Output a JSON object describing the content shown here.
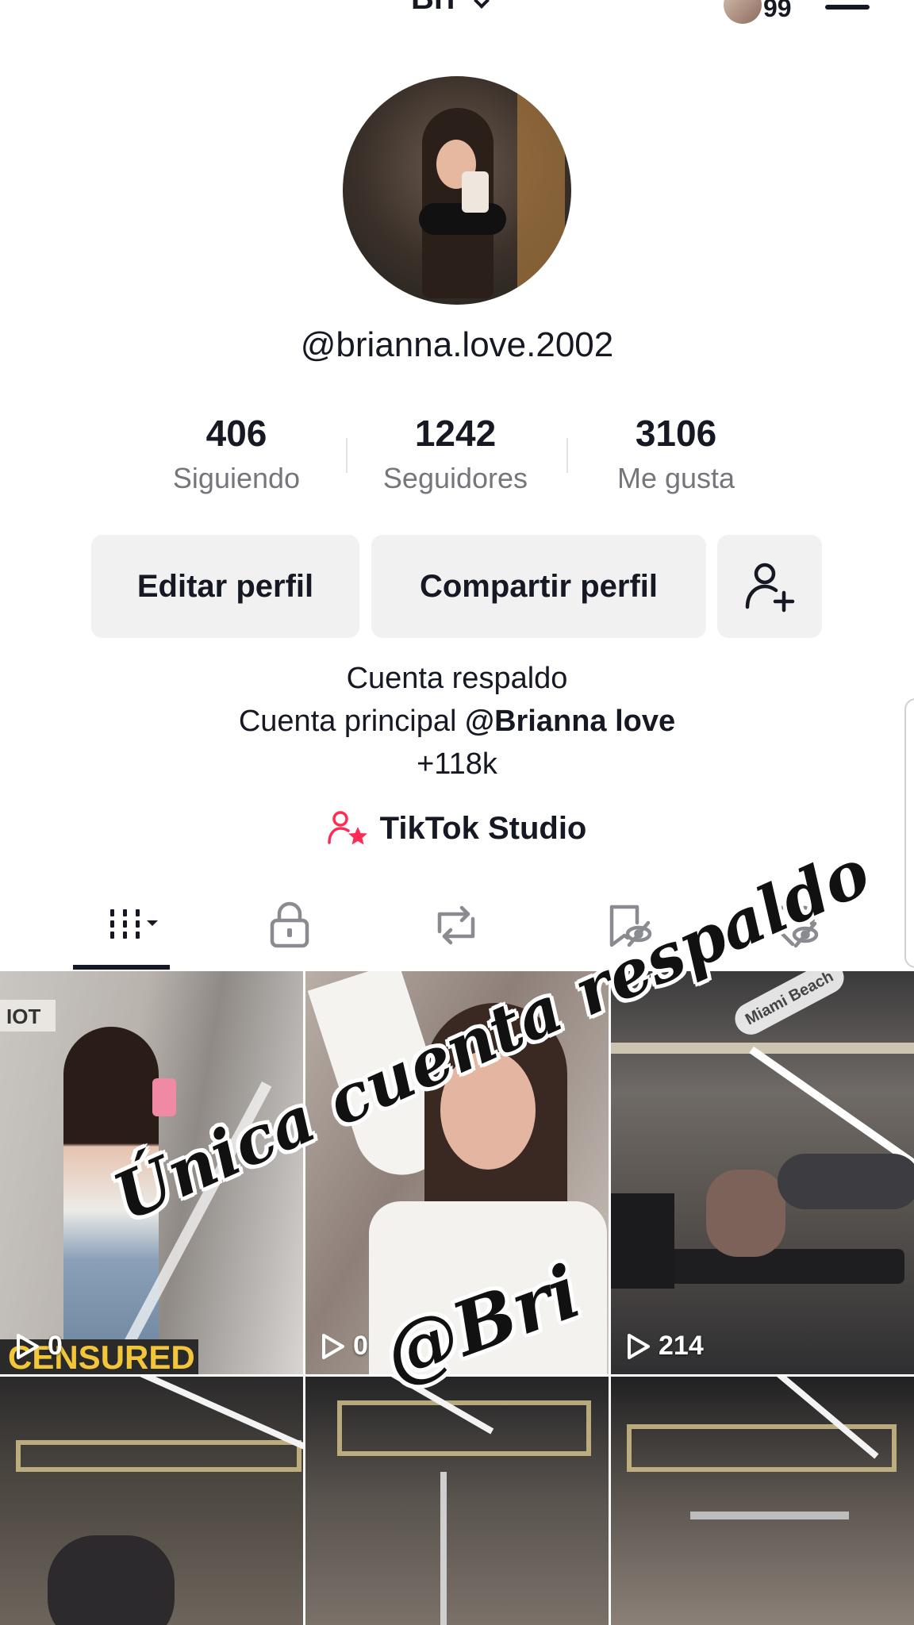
{
  "header": {
    "title": "Bri",
    "notification_count": "99"
  },
  "profile": {
    "username": "@brianna.love.2002"
  },
  "stats": [
    {
      "value": "406",
      "label": "Siguiendo"
    },
    {
      "value": "1242",
      "label": "Seguidores"
    },
    {
      "value": "3106",
      "label": "Me gusta"
    }
  ],
  "actions": {
    "edit_label": "Editar perfil",
    "share_label": "Compartir perfil"
  },
  "bio": {
    "line1": "Cuenta respaldo",
    "line2_prefix": "Cuenta principal ",
    "line2_mention": "@Brianna love",
    "line3": "+118k"
  },
  "studio": {
    "label": "TikTok Studio"
  },
  "tabs": [
    {
      "icon": "grid-icon",
      "active": true
    },
    {
      "icon": "lock-icon",
      "active": false
    },
    {
      "icon": "repost-icon",
      "active": false
    },
    {
      "icon": "bookmark-hidden-icon",
      "active": false
    },
    {
      "icon": "liked-hidden-icon",
      "active": false
    }
  ],
  "videos": [
    {
      "views": "0",
      "sticker": "IOT",
      "banner": "CENSURED"
    },
    {
      "views": "0"
    },
    {
      "views": "214",
      "location": "Miami Beach"
    },
    {
      "views": ""
    },
    {
      "views": ""
    },
    {
      "views": ""
    }
  ],
  "overlay": {
    "line1": "Única cuenta respaldo",
    "line2": "@Bri"
  },
  "colors": {
    "accent": "#fe2c55",
    "text": "#161823",
    "muted": "#75767c",
    "button_bg": "#f1f1f2"
  }
}
